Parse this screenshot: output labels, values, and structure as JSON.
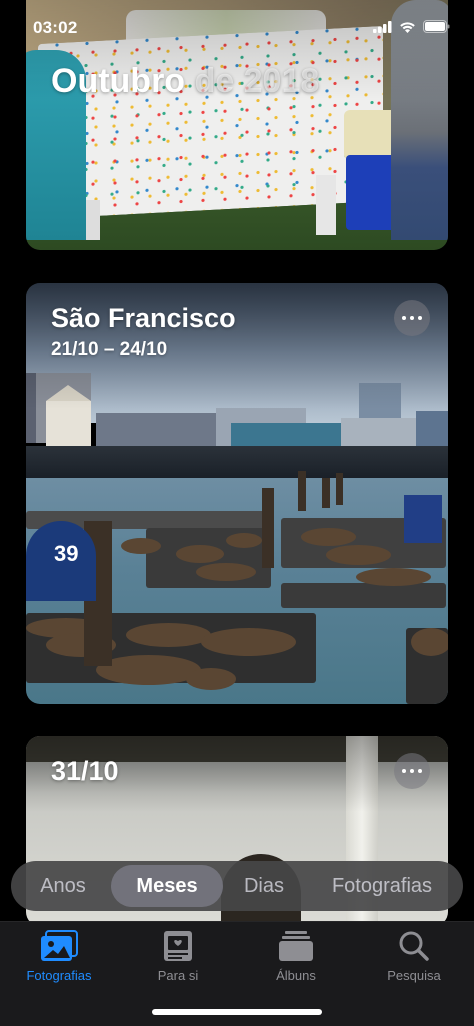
{
  "status_bar": {
    "time": "03:02"
  },
  "cards": [
    {
      "title_main": "Outubro",
      "title_rest": " de 2018"
    },
    {
      "title": "São Francisco",
      "subtitle": "21/10 – 24/10"
    },
    {
      "title": "31/10"
    }
  ],
  "photo_text": {
    "pier_sign": "39"
  },
  "segmented_control": {
    "items": [
      "Anos",
      "Meses",
      "Dias",
      "Fotografias"
    ],
    "selected": "Meses"
  },
  "tab_bar": {
    "items": [
      {
        "label": "Fotografias",
        "icon": "photos-icon",
        "active": true
      },
      {
        "label": "Para si",
        "icon": "for-you-icon",
        "active": false
      },
      {
        "label": "Álbuns",
        "icon": "albums-icon",
        "active": false
      },
      {
        "label": "Pesquisa",
        "icon": "search-icon",
        "active": false
      }
    ]
  },
  "colors": {
    "accent": "#1f8cff",
    "tab_inactive": "#8e8e93",
    "background": "#000000"
  }
}
